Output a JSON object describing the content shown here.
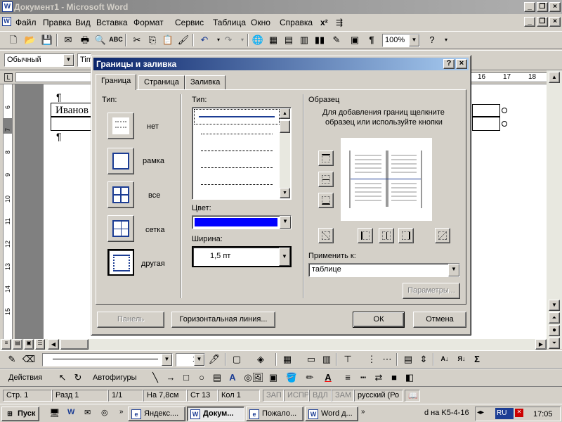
{
  "window": {
    "title": "Документ1 - Microsoft Word",
    "icon": "word-icon"
  },
  "menu": [
    "Файл",
    "Правка",
    "Вид",
    "Вставка",
    "Формат",
    "Сервис",
    "Таблица",
    "Окно",
    "Справка"
  ],
  "toolbar": {
    "zoom": "100%",
    "style": "Обычный",
    "font": "Tim"
  },
  "ruler": {
    "numbers": [
      "16",
      "17",
      "18"
    ]
  },
  "vruler": {
    "numbers": [
      "6",
      "7",
      "8",
      "9",
      "10",
      "11",
      "12",
      "13",
      "14",
      "15"
    ]
  },
  "document": {
    "cell_text": "Иванов",
    "para_mark": "¶"
  },
  "dialog": {
    "title": "Границы и заливка",
    "tabs": [
      "Граница",
      "Страница",
      "Заливка"
    ],
    "type_label": "Тип:",
    "presets": [
      "нет",
      "рамка",
      "все",
      "сетка",
      "другая"
    ],
    "style_label": "Тип:",
    "color_label": "Цвет:",
    "color_value": "#0000ff",
    "width_label": "Ширина:",
    "width_value": "1,5 пт",
    "preview_label": "Образец",
    "preview_hint_1": "Для добавления границ щелкните",
    "preview_hint_2": "образец или используйте кнопки",
    "apply_label": "Применить к:",
    "apply_value": "таблице",
    "params_button": "Параметры...",
    "panel_button": "Панель",
    "hline_button": "Горизонтальная линия...",
    "ok_button": "ОК",
    "cancel_button": "Отмена"
  },
  "drawbar": {
    "line_width": "1",
    "actions_label": "Действия",
    "autoshapes_label": "Автофигуры"
  },
  "status": {
    "page": "Стр. 1",
    "section": "Разд 1",
    "pages": "1/1",
    "position": "На 7,8см",
    "line": "Ст 13",
    "col": "Кол 1",
    "rec": "ЗАП",
    "trk": "ИСПР",
    "ext": "ВДЛ",
    "ovr": "ЗАМ",
    "lang": "русский (Ро"
  },
  "taskbar": {
    "start": "Пуск",
    "tasks": [
      "Яндекс....",
      "Докум...",
      "Пожало...",
      "Word д..."
    ],
    "tray_text": "d на K5-4-16",
    "lang": "RU",
    "clock": "17:05"
  }
}
